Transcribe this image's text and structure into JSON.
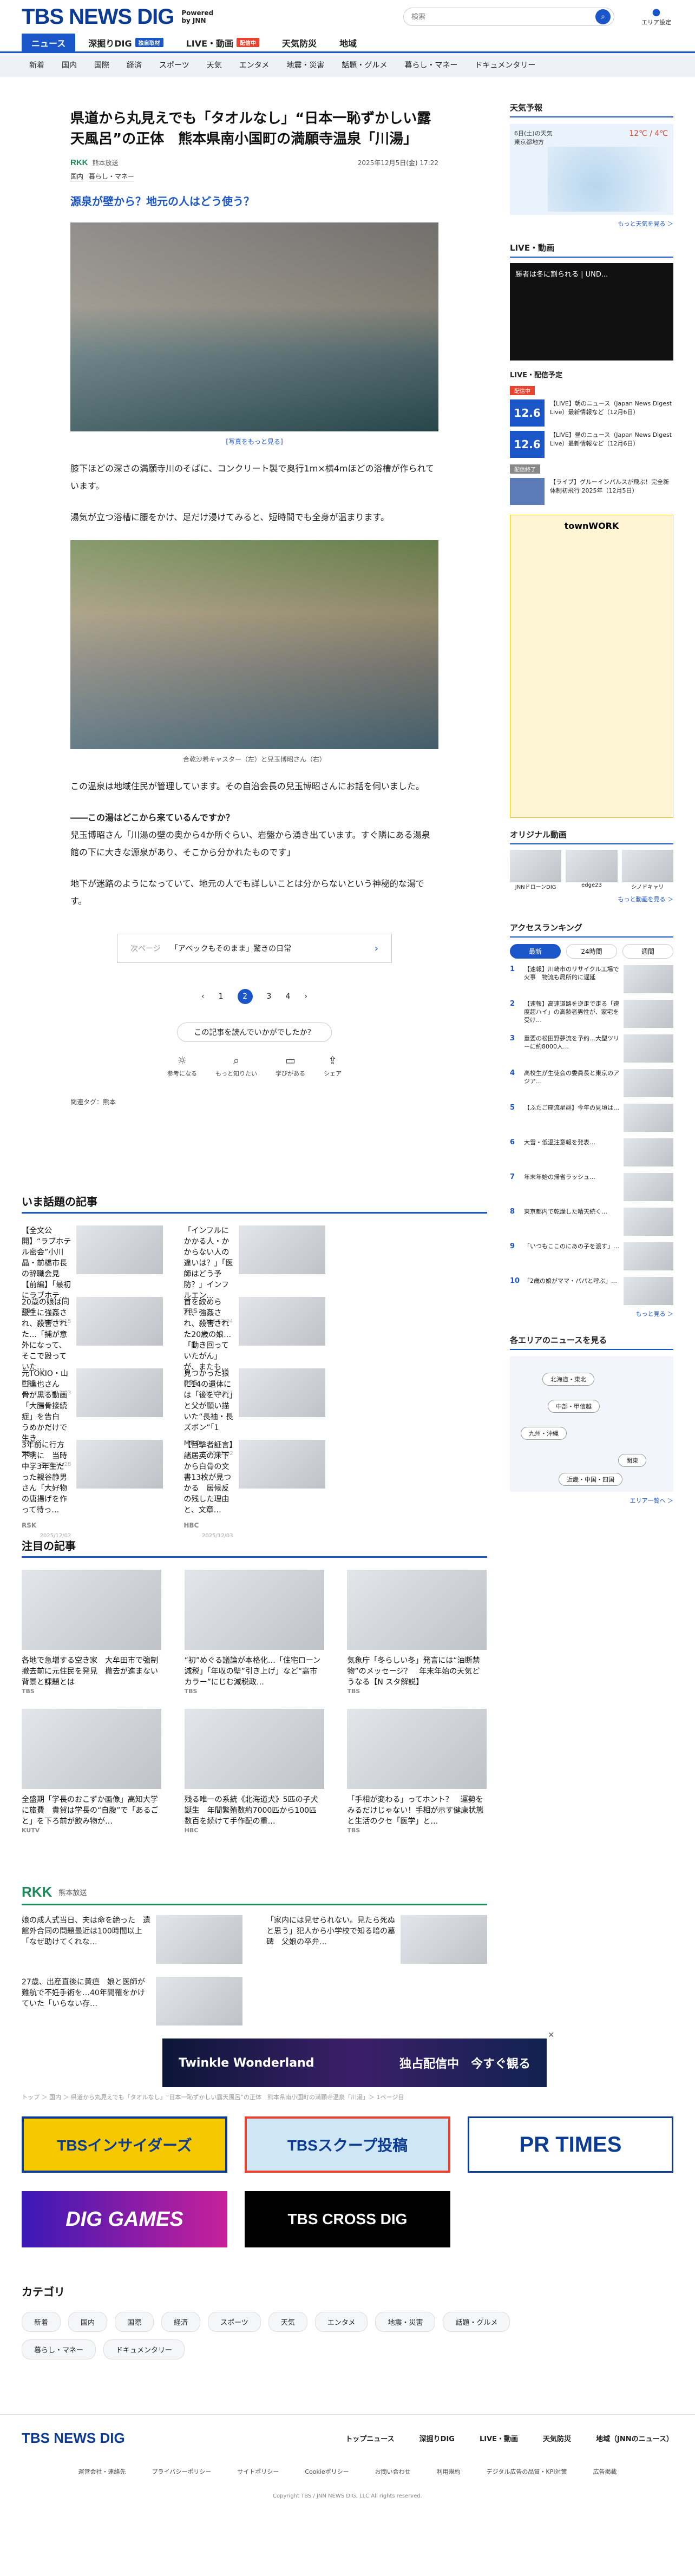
{
  "header": {
    "logo": "TBS NEWS DIG",
    "powered_line1": "Powered",
    "powered_line2": "by JNN",
    "search_placeholder": "検索",
    "area_label": "エリア設定"
  },
  "nav_primary": [
    {
      "label": "ニュース",
      "active": true,
      "badge": ""
    },
    {
      "label": "深掘りDIG",
      "badge": "独自取材"
    },
    {
      "label": "LIVE・動画",
      "badge": "配信中"
    },
    {
      "label": "天気防災",
      "badge": ""
    },
    {
      "label": "地域",
      "badge": ""
    }
  ],
  "nav_secondary": [
    "新着",
    "国内",
    "国際",
    "経済",
    "スポーツ",
    "天気",
    "エンタメ",
    "地震・災害",
    "話題・グルメ",
    "暮らし・マネー",
    "ドキュメンタリー"
  ],
  "article": {
    "headline": "県道から丸見えでも「タオルなし」“日本一恥ずかしい露天風呂”の正体　熊本県南小国町の満願寺温泉「川湯」",
    "brand": "RKK",
    "brand_name": "熊本放送",
    "date": "2025年12月5日(金) 17:22",
    "categories": [
      "国内",
      "暮らし・マネー"
    ],
    "subhead": "源泉が壁から？地元の人はどう使う？",
    "caption1": "[写真をもっと見る]",
    "para1": "膝下ほどの深さの満願寺川のそばに、コンクリート製で奥行1m×横4mほどの浴槽が作られています。",
    "para2": "湯気が立つ浴槽に腰をかけ、足だけ浸けてみると、短時間でも全身が温まります。",
    "caption2": "合乾沙希キャスター（左）と兒玉博昭さん（右）",
    "para3": "この温泉は地域住民が管理しています。その自治会長の兒玉博昭さんにお話を伺いました。",
    "para4a": "――この湯はどこから来ているんですか？",
    "para4b": "兒玉博昭さん「川湯の壁の奥から4か所ぐらい、岩盤から湧き出ています。すぐ隣にある湯泉館の下に大きな源泉があり、そこから分かれたものです」",
    "para5": "地下が迷路のようになっていて、地元の人でも詳しいことは分からないという神秘的な湯です。",
    "related_label": "次ページ",
    "related_title": "「アベックもそのまま」驚きの日常",
    "pages": [
      "1",
      "2",
      "3",
      "4"
    ],
    "current_page": "2",
    "helpful": "この記事を読んでいかがでしたか？",
    "reactions": [
      "参考になる",
      "もっと知りたい",
      "学びがある",
      "シェア"
    ],
    "tags": "関連タグ：熊本"
  },
  "trending": {
    "title": "いま話題の記事",
    "items": [
      {
        "text": "【全文公開】“ラブホテル密会”小川晶・前橋市長の辞職会見【前編】「最初にラブホテ…",
        "src": "TBS",
        "date": "2025/10/15"
      },
      {
        "text": "「インフルにかかる人・かからない人の違いは？」「医師はどう予防？」インフルエン…",
        "src": "TBS",
        "date": "2025/12/04"
      },
      {
        "text": "",
        "src": "",
        "date": ""
      },
      {
        "text": "20歳の娘は同級生に強姦され、殺害された…「捕が意外になって、そこで殴っていた…",
        "src": "BSS",
        "date": "2025/12/03"
      },
      {
        "text": "首を絞められ、強姦され、殺害された20歳の娘…「動き回っていたがん」が、またも…",
        "src": "BSS",
        "date": "2025/12/01"
      },
      {
        "text": "",
        "src": "",
        "date": ""
      },
      {
        "text": "元TOKIO・山口達也さん　骨が黒る動画「大腸骨接続症」を告白　うめかだけで生き…",
        "src": "TBS",
        "date": "2025/11/28"
      },
      {
        "text": "見つかった狼に14の遺体には「後を守れ」と父が願い描いた“長袖・長ズボン”「1",
        "src": "MRO",
        "date": "2025/12/02"
      },
      {
        "text": "",
        "src": "",
        "date": ""
      },
      {
        "text": "3年前に行方不明に　当時中学3年生だった親谷静男さん「大好物の唐揚げを作って待っ…",
        "src": "RSK",
        "date": "2025/12/02"
      },
      {
        "text": "【目撃者証言】諸居英の床下から白骨の文書13枚が見つかる　居候反の残した理由と、文章…",
        "src": "HBC",
        "date": "2025/12/03"
      },
      {
        "text": "",
        "src": "",
        "date": ""
      }
    ]
  },
  "featured": {
    "title": "注目の記事",
    "items": [
      {
        "text": "各地で急増する空き家　大牟田市で強制撤去前に元住民を発見　撤去が進まない背景と課題とは",
        "src": "TBS",
        "date": "2025/12/03"
      },
      {
        "text": "“初”めぐる議論が本格化…「住宅ローン減税」「年収の壁”引き上げ」など“高市カラー”にじむ減税政…",
        "src": "TBS",
        "date": "2025/12/05"
      },
      {
        "text": "気象庁「冬らしい冬」発言には“油断禁物”のメッセージ？　年末年始の天気どうなる【N スタ解説】",
        "src": "TBS",
        "date": "2025/12/03"
      },
      {
        "text": "全盛期「学長のおこずか画像」高知大学に旅費　貴賀は学長の“自腹”で「あるごと」を下ろ前が飲み物が…",
        "src": "KUTV",
        "date": "2025/12/04"
      },
      {
        "text": "残る唯一の系統《北海道犬》5匹の子犬誕生　年間繁殖数約7000匹から100匹　数百を続けて手作配の重…",
        "src": "HBC",
        "date": "2025/12/01"
      },
      {
        "text": "「手相が変わる」ってホント？　運勢をみるだけじゃない！手相が示す健康状態と生活のクセ「医学」と…",
        "src": "TBS",
        "date": "2025/12/02"
      }
    ]
  },
  "rkk_section": {
    "logo": "RKK",
    "name": "熊本放送",
    "items": [
      {
        "text": "娘の成人式当日、夫は命を絶った　遺館外合同の問題最近は100時間以上「なぜ助けてくれな…",
        "date": "2025/12/04"
      },
      {
        "text": "「家内には見せられない。見たら死ぬと思う」犯人から小学校で知る暗の墓碑　父娘の卒弁…",
        "date": "2025/12/03"
      },
      {
        "text": "27歳、出産直後に黄疸　娘と医師が難航で不妊手術を…40年間罹をかけていた「いらない存…",
        "date": "2025/12/02"
      }
    ]
  },
  "ad_banner": {
    "left": "Twinkle Wonderland",
    "right": "独占配信中　今すぐ観る"
  },
  "breadcrumb": "トップ ＞ 国内 ＞ 県道から丸見えでも「タオルなし」“日本一恥ずかしい露天風呂”の正体　熊本県南小国町の満願寺温泉「川湯」＞ 1ページ目",
  "banners": [
    "TBSインサイダーズ",
    "TBSスクープ投稿",
    "PR TIMES",
    "DIG GAMES",
    "TBS CROSS DIG"
  ],
  "categories_section": {
    "title": "カテゴリ",
    "chips": [
      "新着",
      "国内",
      "国際",
      "経済",
      "スポーツ",
      "天気",
      "エンタメ",
      "地震・災害",
      "話題・グルメ",
      "暮らし・マネー",
      "ドキュメンタリー"
    ]
  },
  "footer": {
    "logo": "TBS NEWS DIG",
    "links": [
      "トップニュース",
      "深掘りDIG",
      "LIVE・動画",
      "天気防災",
      "地域（JNNのニュース）"
    ],
    "sublinks": [
      "運営会社・連絡先",
      "プライバシーポリシー",
      "サイトポリシー",
      "Cookieポリシー",
      "お問い合わせ",
      "利用規約",
      "デジタル広告の品質・KPI対策",
      "広告掲載"
    ],
    "copyright": "Copyright TBS / JNN NEWS DIG, LLC All rights reserved."
  },
  "sidebar": {
    "weather_title": "天気予報",
    "weather_date": "6日(土)の天気",
    "weather_place": "東京都地方",
    "weather_temp": "12℃ / 4℃",
    "weather_more": "もっと天気を見る ＞",
    "live_title": "LIVE・動画",
    "live_video_title": "勝者は冬に割られる | UND...",
    "live_sched_title": "LIVE・配信予定",
    "live_items": [
      {
        "tag": "配信中",
        "date": "12.6",
        "text": "【LIVE】朝のニュース（Japan News Digest Live）最新情報など（12月6日）"
      },
      {
        "tag": "",
        "date": "12.6",
        "text": "【LIVE】昼のニュース（Japan News Digest Live）最新情報など（12月6日）"
      },
      {
        "tag": "配信終了",
        "date": "",
        "text": "【ライブ】グルーインパルスが飛ぶ！完全新体制初飛行 2025年（12月5日）"
      }
    ],
    "sidead_title": "townWORK",
    "original_title": "オリジナル動画",
    "original_items": [
      "JNNドローンDIG",
      "edge23",
      "シノドキャリ"
    ],
    "original_more": "もっと動画を見る ＞",
    "ranking_title": "アクセスランキング",
    "ranking_tabs": [
      "最新",
      "24時間",
      "週間"
    ],
    "ranking_items": [
      {
        "num": "1",
        "text": "【速報】川崎市のリサイクル工場で火事　物流も局所的に遅延"
      },
      {
        "num": "2",
        "text": "【速報】高速道路を逆走で走る「速度超ハイ」の高齢者男性が、家宅を受け…"
      },
      {
        "num": "3",
        "text": "重要の松田野夢流を予約…大型ツリーに約8000人…"
      },
      {
        "num": "4",
        "text": "高校生が生徒会の委員長と東京のアジア…"
      },
      {
        "num": "5",
        "text": "【ふたご座流星群】今年の見頃は…"
      },
      {
        "num": "6",
        "text": "大雪・低温注意報を発表…"
      },
      {
        "num": "7",
        "text": "年末年始の帰省ラッシュ…"
      },
      {
        "num": "8",
        "text": "東京都内で乾燥した晴天続く…"
      },
      {
        "num": "9",
        "text": "「いつもここのにあの子を渡す」…"
      },
      {
        "num": "10",
        "text": "「2歳の娘がママ・パパと呼ぶ」…"
      }
    ],
    "ranking_more": "もっと見る ＞",
    "areas_title": "各エリアのニュースを見る",
    "areas": [
      "北海道・東北",
      "中部・甲信越",
      "九州・沖縄",
      "関東",
      "近畿・中国・四国"
    ],
    "areas_more": "エリア一覧へ ＞"
  }
}
